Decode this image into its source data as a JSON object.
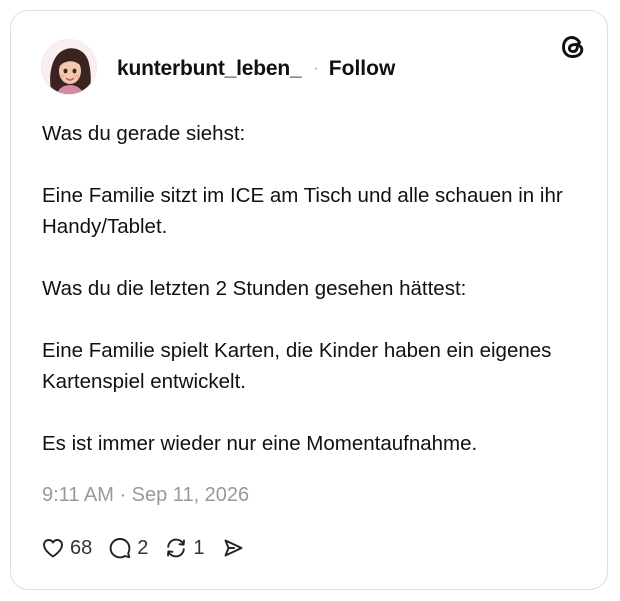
{
  "post": {
    "username": "kunterbunt_leben_",
    "separator": "·",
    "follow_label": "Follow",
    "paragraphs": [
      "Was du gerade siehst:",
      "Eine Familie sitzt im ICE am Tisch und alle schauen in ihr Handy/Tablet.",
      "Was du die letzten 2 Stunden gesehen hättest:",
      "Eine Familie spielt Karten, die Kinder haben ein eigenes Kartenspiel entwickelt.",
      "Es ist immer wieder nur eine Momentaufnahme."
    ],
    "timestamp": "9:11 AM · Sep 11, 2026"
  },
  "actions": {
    "likes": "68",
    "replies": "2",
    "reposts": "1"
  },
  "icons": {
    "avatar": "avatar-illustration",
    "logo": "threads-logo-icon",
    "like": "heart-icon",
    "reply": "comment-icon",
    "repost": "repost-icon",
    "share": "share-icon"
  },
  "colors": {
    "text": "#111111",
    "muted": "#999999",
    "border": "#dedede"
  }
}
